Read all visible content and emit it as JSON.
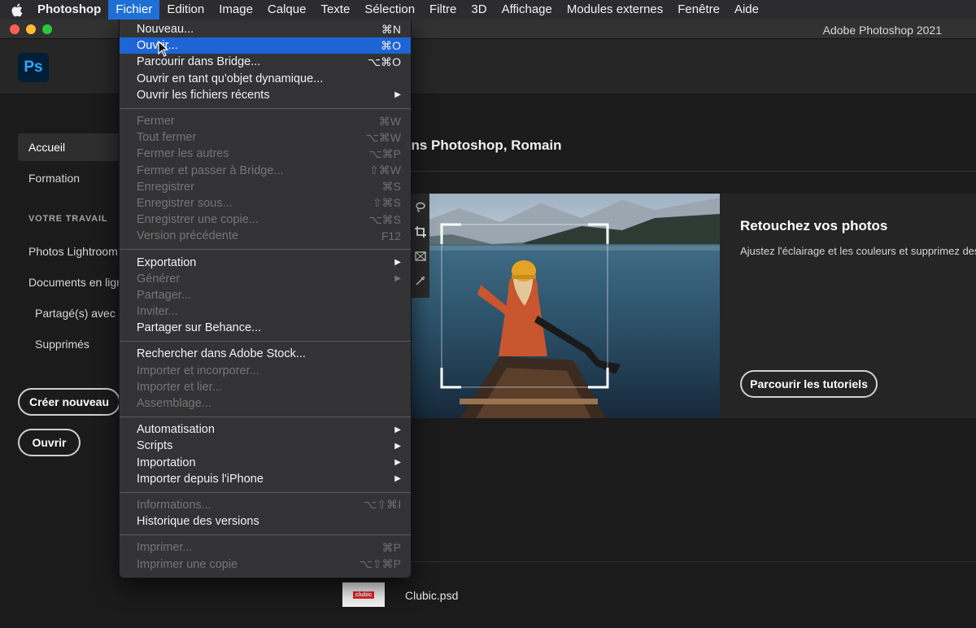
{
  "menubar": {
    "app": "Photoshop",
    "items": [
      "Fichier",
      "Edition",
      "Image",
      "Calque",
      "Texte",
      "Sélection",
      "Filtre",
      "3D",
      "Affichage",
      "Modules externes",
      "Fenêtre",
      "Aide"
    ],
    "active": "Fichier"
  },
  "window": {
    "title": "Adobe Photoshop 2021"
  },
  "app": {
    "logo_text": "Ps"
  },
  "sidebar": {
    "home": "Accueil",
    "learn": "Formation",
    "section_heading": "VOTRE TRAVAIL",
    "lightroom": "Photos Lightroom",
    "cloud_docs": "Documents en ligne",
    "shared": "Partagé(s) avec vous",
    "deleted": "Supprimés",
    "create_new": "Créer nouveau",
    "open": "Ouvrir"
  },
  "main": {
    "welcome": "ans Photoshop, Romain",
    "hero": {
      "title": "Retouchez vos photos",
      "description": "Ajustez l'éclairage et les couleurs et supprimez des",
      "button": "Parcourir les tutoriels"
    },
    "recent_file": {
      "name": "Clubic.psd",
      "thumb_text": "clubic"
    }
  },
  "file_menu": {
    "groups": [
      [
        {
          "label": "Nouveau...",
          "shortcut": "⌘N",
          "enabled": true
        },
        {
          "label": "Ouvrir...",
          "shortcut": "⌘O",
          "enabled": true,
          "highlighted": true
        },
        {
          "label": "Parcourir dans Bridge...",
          "shortcut": "⌥⌘O",
          "enabled": true
        },
        {
          "label": "Ouvrir en tant qu'objet dynamique...",
          "shortcut": "",
          "enabled": true
        },
        {
          "label": "Ouvrir les fichiers récents",
          "shortcut": "",
          "enabled": true,
          "submenu": true
        }
      ],
      [
        {
          "label": "Fermer",
          "shortcut": "⌘W",
          "enabled": false
        },
        {
          "label": "Tout fermer",
          "shortcut": "⌥⌘W",
          "enabled": false
        },
        {
          "label": "Fermer les autres",
          "shortcut": "⌥⌘P",
          "enabled": false
        },
        {
          "label": "Fermer et passer à Bridge...",
          "shortcut": "⇧⌘W",
          "enabled": false
        },
        {
          "label": "Enregistrer",
          "shortcut": "⌘S",
          "enabled": false
        },
        {
          "label": "Enregistrer sous...",
          "shortcut": "⇧⌘S",
          "enabled": false
        },
        {
          "label": "Enregistrer une copie...",
          "shortcut": "⌥⌘S",
          "enabled": false
        },
        {
          "label": "Version précédente",
          "shortcut": "F12",
          "enabled": false
        }
      ],
      [
        {
          "label": "Exportation",
          "shortcut": "",
          "enabled": true,
          "submenu": true
        },
        {
          "label": "Générer",
          "shortcut": "",
          "enabled": false,
          "submenu": true
        },
        {
          "label": "Partager...",
          "shortcut": "",
          "enabled": false
        },
        {
          "label": "Inviter...",
          "shortcut": "",
          "enabled": false
        },
        {
          "label": "Partager sur Behance...",
          "shortcut": "",
          "enabled": true
        }
      ],
      [
        {
          "label": "Rechercher dans Adobe Stock...",
          "shortcut": "",
          "enabled": true
        },
        {
          "label": "Importer et incorporer...",
          "shortcut": "",
          "enabled": false
        },
        {
          "label": "Importer et lier...",
          "shortcut": "",
          "enabled": false
        },
        {
          "label": "Assemblage...",
          "shortcut": "",
          "enabled": false
        }
      ],
      [
        {
          "label": "Automatisation",
          "shortcut": "",
          "enabled": true,
          "submenu": true
        },
        {
          "label": "Scripts",
          "shortcut": "",
          "enabled": true,
          "submenu": true
        },
        {
          "label": "Importation",
          "shortcut": "",
          "enabled": true,
          "submenu": true
        },
        {
          "label": "Importer depuis l'iPhone",
          "shortcut": "",
          "enabled": true,
          "submenu": true
        }
      ],
      [
        {
          "label": "Informations...",
          "shortcut": "⌥⇧⌘I",
          "enabled": false
        },
        {
          "label": "Historique des versions",
          "shortcut": "",
          "enabled": true
        }
      ],
      [
        {
          "label": "Imprimer...",
          "shortcut": "⌘P",
          "enabled": false
        },
        {
          "label": "Imprimer une copie",
          "shortcut": "⌥⇧⌘P",
          "enabled": false
        }
      ]
    ]
  },
  "colors": {
    "menu_highlight": "#1d64d6",
    "menubar_active": "#1f6fd6",
    "ps_logo_bg": "#001e36",
    "ps_logo_fg": "#31a8ff",
    "traffic_red": "#ff5f57",
    "traffic_yellow": "#febc2e",
    "traffic_green": "#28c840"
  },
  "icons": [
    "apple-icon",
    "lasso-icon",
    "crop-icon",
    "frame-icon",
    "eyedropper-icon",
    "cursor-icon"
  ]
}
